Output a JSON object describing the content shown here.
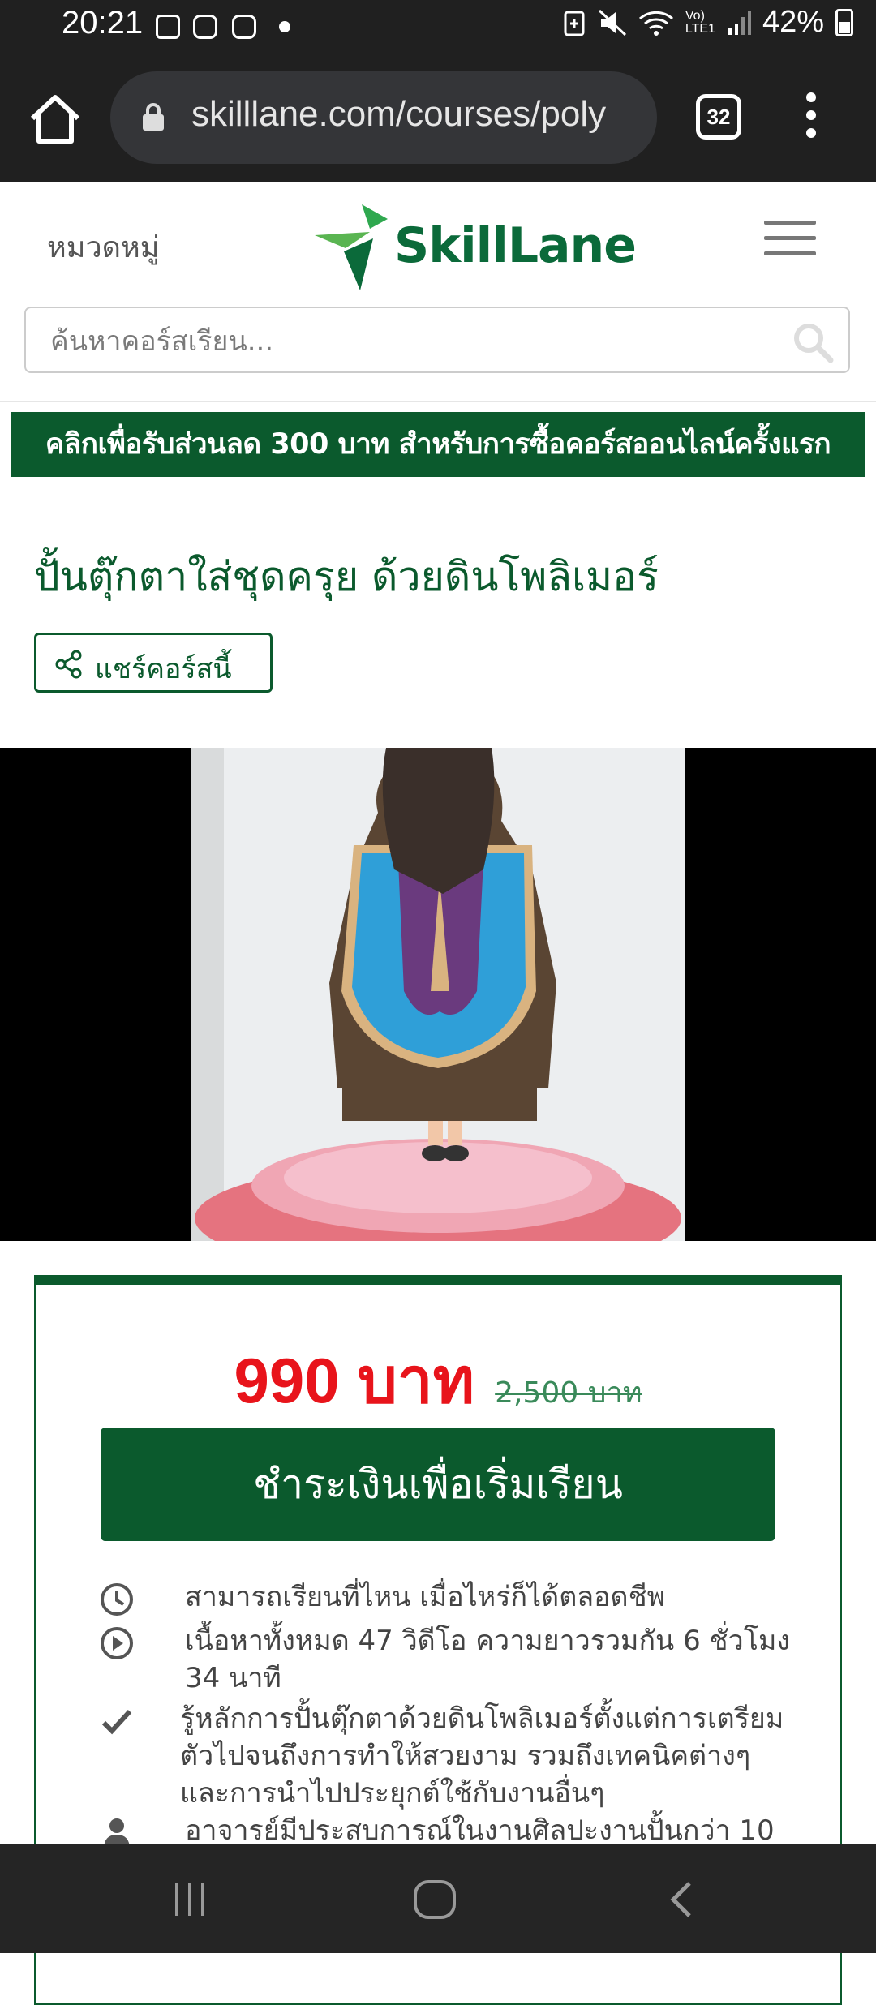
{
  "status_bar": {
    "time": "20:21",
    "battery": "42%",
    "left_icons": [
      "gallery-icon",
      "instagram-icon",
      "instagram-icon",
      "dot-icon"
    ],
    "right_icons": [
      "battery-saver-icon",
      "mute-icon",
      "wifi-icon",
      "volte-icon",
      "signal-icon",
      "battery-icon"
    ]
  },
  "browser": {
    "url": "skilllane.com/courses/poly",
    "tab_count": "32"
  },
  "header": {
    "category_label": "หมวดหมู่",
    "logo_text": "SkillLane",
    "search_placeholder": "ค้นหาคอร์สเรียน..."
  },
  "promo": {
    "text": "คลิกเพื่อรับส่วนลด 300 บาท สำหรับการซื้อคอร์สออนไลน์ครั้งแรก"
  },
  "course": {
    "title": "ปั้นตุ๊กตาใส่ชุดครุย  ด้วยดินโพลิเมอร์",
    "share_label": "แชร์คอร์สนี้"
  },
  "pricing": {
    "current_price": "990  บาท",
    "old_price": "2,500  บาท",
    "pay_button": "ชำระเงินเพื่อเริ่มเรียน",
    "features": [
      {
        "icon": "clock-icon",
        "text": "สามารถเรียนที่ไหน  เมื่อไหร่ก็ได้ตลอดชีพ"
      },
      {
        "icon": "play-icon",
        "text": "เนื้อหาทั้งหมด  47  วิดีโอ  ความยาวรวมกัน  6  ชั่วโมง  34  นาที"
      },
      {
        "icon": "check-icon",
        "text": "รู้หลักการปั้นตุ๊กตาด้วยดินโพลิเมอร์ตั้งแต่การเตรียมตัวไปจนถึงการทำให้สวยงาม  รวมถึงเทคนิคต่างๆและการนำไปประยุกต์ใช้กับงานอื่นๆ"
      },
      {
        "icon": "user-icon",
        "text": "อาจารย์มีประสบการณ์ในงานศิลปะงานปั้นกว่า  10"
      }
    ]
  },
  "colors": {
    "brand_green": "#0b5a2d",
    "price_red": "#e8141b"
  }
}
